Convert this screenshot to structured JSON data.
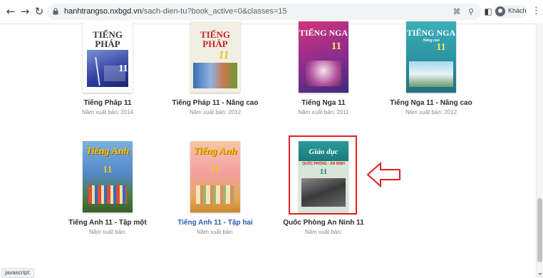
{
  "browser": {
    "url_host": "hanhtrangso.nxbgd.vn",
    "url_path": "/sach-dien-tu?book_active=0&classes=15",
    "profile_label": "Khách",
    "status_text": "javascript:"
  },
  "books": [
    {
      "title": "Tiếng Pháp 11",
      "year": "Năm xuất bản: 2014",
      "cover_text": "TIẾNG PHÁP",
      "cover_num": "11"
    },
    {
      "title": "Tiếng Pháp 11 - Nâng cao",
      "year": "Năm xuất bản: 2012",
      "cover_text": "TIẾNG PHÁP",
      "cover_num": "11"
    },
    {
      "title": "Tiếng Nga 11",
      "year": "Năm xuất bản: 2011",
      "cover_text": "TIẾNG NGA",
      "cover_num": "11"
    },
    {
      "title": "Tiếng Nga 11 - Nâng cao",
      "year": "Năm xuất bản: 2012",
      "cover_text": "TIẾNG NGA",
      "cover_sub": "Nâng cao",
      "cover_num": "11"
    },
    {
      "title": "Tiếng Anh 11 - Tập một",
      "year": "Năm xuất bản:",
      "cover_text": "Tiếng Anh",
      "cover_num": "11"
    },
    {
      "title": "Tiếng Anh 11 - Tập hai",
      "year": "Năm xuất bản:",
      "cover_text": "Tiếng Anh",
      "cover_num": "11"
    },
    {
      "title": "Quốc Phòng An Ninh 11",
      "year": "Năm xuất bản:",
      "cover_text": "Giáo dục",
      "cover_sub": "QUỐC PHÒNG - AN NINH",
      "cover_num": "11"
    }
  ],
  "colors": {
    "highlight": "#e02020",
    "link": "#2a5bb5"
  },
  "icons": [
    "back-icon",
    "forward-icon",
    "reload-icon",
    "lock-icon",
    "qr-icon",
    "zoom-icon",
    "sidepanel-icon",
    "profile-icon",
    "menu-icon",
    "left-arrow-icon"
  ]
}
